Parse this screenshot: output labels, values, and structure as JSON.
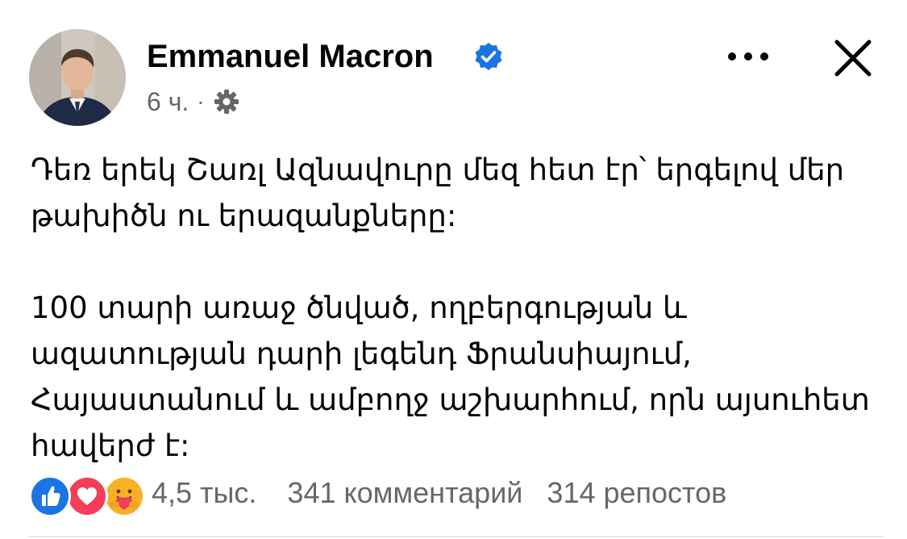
{
  "post": {
    "author": "Emmanuel Macron",
    "time": "6 ч.",
    "separator": "·",
    "paragraphs": [
      "Դեռ երեկ Շառլ Ազնավուրը մեզ հետ էր՝ երգելով մեր թախիծն ու երազանքները:",
      "100 տարի առաջ ծնված, ողբերգության և ազատության դարի լեգենդ Ֆրանսիայում, Հայաստանում և ամբողջ աշխարհում, որն այսուհետ հավերժ է:"
    ]
  },
  "reactions": {
    "count": "4,5 тыс.",
    "comments": "341 комментарий",
    "shares": "314 репостов",
    "types": [
      "like",
      "love",
      "care"
    ]
  },
  "icons": {
    "verified": "verified-badge-icon",
    "audience": "gear-icon",
    "more": "more-dots-icon",
    "close": "close-icon"
  },
  "colors": {
    "verified_blue": "#1b74e4",
    "secondary_text": "#65676b",
    "primary_text": "#050505",
    "love_red": "#f33e58",
    "care_yellow": "#f7b125"
  }
}
